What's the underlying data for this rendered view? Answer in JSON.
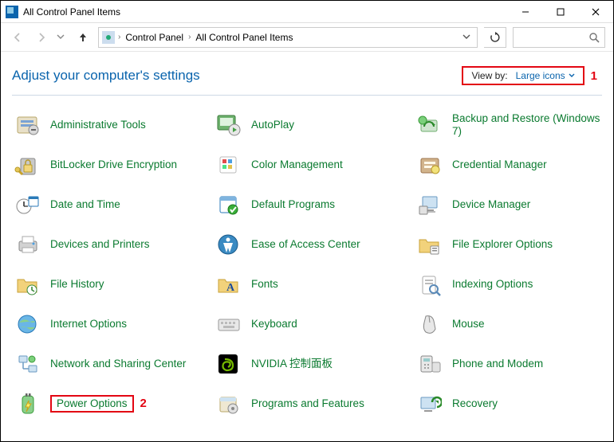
{
  "window": {
    "title": "All Control Panel Items"
  },
  "breadcrumb": {
    "root": "Control Panel",
    "current": "All Control Panel Items"
  },
  "heading": "Adjust your computer's settings",
  "viewby": {
    "label": "View by:",
    "value": "Large icons"
  },
  "annotations": {
    "one": "1",
    "two": "2"
  },
  "items": [
    {
      "label": "Administrative Tools",
      "icon": "admin-tools-icon"
    },
    {
      "label": "AutoPlay",
      "icon": "autoplay-icon"
    },
    {
      "label": "Backup and Restore (Windows 7)",
      "icon": "backup-restore-icon",
      "twoline": true
    },
    {
      "label": "BitLocker Drive Encryption",
      "icon": "bitlocker-icon"
    },
    {
      "label": "Color Management",
      "icon": "color-mgmt-icon"
    },
    {
      "label": "Credential Manager",
      "icon": "credential-icon"
    },
    {
      "label": "Date and Time",
      "icon": "datetime-icon"
    },
    {
      "label": "Default Programs",
      "icon": "default-programs-icon"
    },
    {
      "label": "Device Manager",
      "icon": "device-manager-icon"
    },
    {
      "label": "Devices and Printers",
      "icon": "devices-printers-icon"
    },
    {
      "label": "Ease of Access Center",
      "icon": "ease-access-icon"
    },
    {
      "label": "File Explorer Options",
      "icon": "file-explorer-opts-icon"
    },
    {
      "label": "File History",
      "icon": "file-history-icon"
    },
    {
      "label": "Fonts",
      "icon": "fonts-icon"
    },
    {
      "label": "Indexing Options",
      "icon": "indexing-icon"
    },
    {
      "label": "Internet Options",
      "icon": "internet-opts-icon"
    },
    {
      "label": "Keyboard",
      "icon": "keyboard-icon"
    },
    {
      "label": "Mouse",
      "icon": "mouse-icon"
    },
    {
      "label": "Network and Sharing Center",
      "icon": "network-sharing-icon",
      "twoline": true
    },
    {
      "label": "NVIDIA 控制面板",
      "icon": "nvidia-icon"
    },
    {
      "label": "Phone and Modem",
      "icon": "phone-modem-icon"
    },
    {
      "label": "Power Options",
      "icon": "power-options-icon",
      "highlight": true
    },
    {
      "label": "Programs and Features",
      "icon": "programs-features-icon"
    },
    {
      "label": "Recovery",
      "icon": "recovery-icon"
    }
  ]
}
